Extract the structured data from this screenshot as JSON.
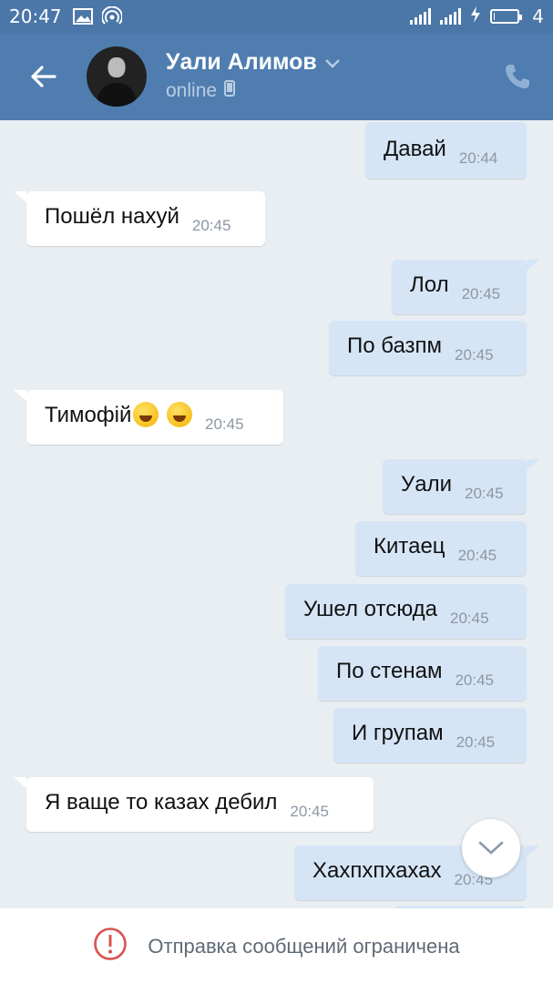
{
  "status_bar": {
    "time": "20:47",
    "battery_level": "4",
    "battery_fraction": 0.04
  },
  "header": {
    "contact_name": "Уали Алимов",
    "contact_status": "online"
  },
  "messages": [
    {
      "dir": "out",
      "text": "Давай",
      "time": "20:44"
    },
    {
      "dir": "in",
      "text": "Пошёл нахуй",
      "time": "20:45"
    },
    {
      "dir": "out",
      "text": "Лол",
      "time": "20:45"
    },
    {
      "dir": "out",
      "text": "По базпм",
      "time": "20:45"
    },
    {
      "dir": "in",
      "text": "Тимофій",
      "emoji_count": 2,
      "time": "20:45"
    },
    {
      "dir": "out",
      "text": "Уали",
      "time": "20:45"
    },
    {
      "dir": "out",
      "text": "Китаец",
      "time": "20:45"
    },
    {
      "dir": "out",
      "text": "Ушел отсюда",
      "time": "20:45"
    },
    {
      "dir": "out",
      "text": "По стенам",
      "time": "20:45"
    },
    {
      "dir": "out",
      "text": "И групам",
      "time": "20:45"
    },
    {
      "dir": "in",
      "text": "Я ваще то казах дебил",
      "time": "20:45"
    },
    {
      "dir": "out",
      "text": "Хахпхпхахах",
      "time": "20:45"
    }
  ],
  "footer": {
    "restriction_text": "Отправка сообщений ограничена"
  },
  "colors": {
    "header": "#4f7db0",
    "status_bar": "#4a76a8",
    "outgoing_bubble": "#d6e5f6",
    "incoming_bubble": "#ffffff",
    "background": "#e9eef2",
    "warning": "#d9534f"
  },
  "icons": [
    "back-arrow-icon",
    "phone-icon",
    "chevron-down-icon",
    "mobile-icon",
    "warning-icon",
    "scroll-down-icon",
    "image-icon",
    "hotspot-icon",
    "signal-icon",
    "charging-icon",
    "battery-icon"
  ]
}
